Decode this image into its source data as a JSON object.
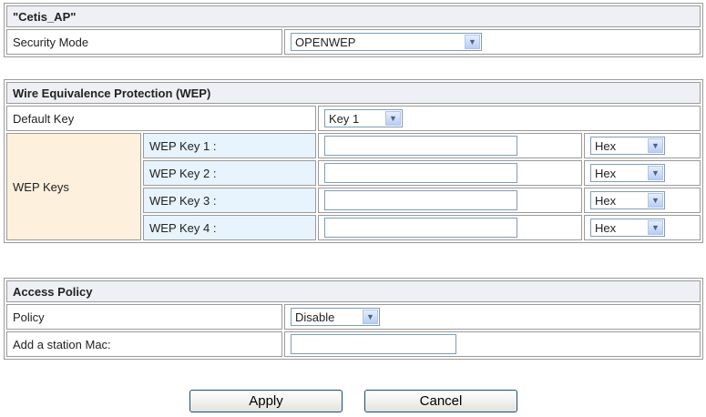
{
  "ssid_header": "\"Cetis_AP\"",
  "security": {
    "label": "Security Mode",
    "mode_value": "OPENWEP"
  },
  "wep": {
    "header": "Wire Equivalence Protection (WEP)",
    "default_key_label": "Default Key",
    "default_key_value": "Key 1",
    "keys_label": "WEP Keys",
    "keys": [
      {
        "label": "WEP Key 1 :",
        "value": "",
        "format": "Hex"
      },
      {
        "label": "WEP Key 2 :",
        "value": "",
        "format": "Hex"
      },
      {
        "label": "WEP Key 3 :",
        "value": "",
        "format": "Hex"
      },
      {
        "label": "WEP Key 4 :",
        "value": "",
        "format": "Hex"
      }
    ]
  },
  "access_policy": {
    "header": "Access Policy",
    "policy_label": "Policy",
    "policy_value": "Disable",
    "station_mac_label": "Add a station Mac:",
    "station_mac_value": ""
  },
  "buttons": {
    "apply": "Apply",
    "cancel": "Cancel"
  }
}
